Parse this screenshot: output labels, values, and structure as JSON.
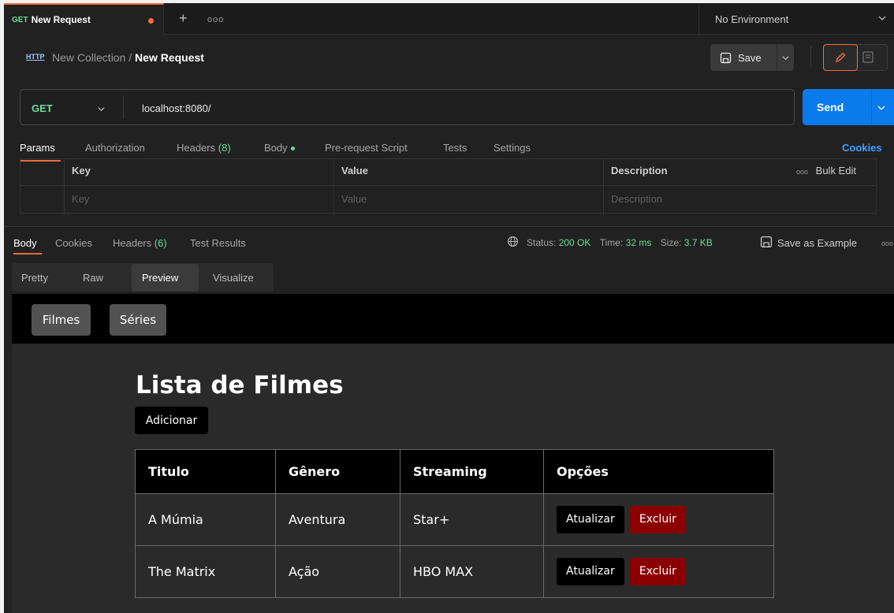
{
  "tab": {
    "method": "GET",
    "title": "New Request",
    "more": "ooo"
  },
  "environment": {
    "label": "No Environment"
  },
  "breadcrumb": {
    "icon_label": "HTTP",
    "collection": "New Collection",
    "separator": "/",
    "request": "New Request"
  },
  "toolbar": {
    "save_label": "Save"
  },
  "request": {
    "method": "GET",
    "url": "localhost:8080/",
    "send_label": "Send"
  },
  "request_tabs": [
    {
      "label": "Params"
    },
    {
      "label": "Authorization"
    },
    {
      "label": "Headers",
      "count": "(8)"
    },
    {
      "label": "Body"
    },
    {
      "label": "Pre-request Script"
    },
    {
      "label": "Tests"
    },
    {
      "label": "Settings"
    }
  ],
  "cookies_label": "Cookies",
  "params_table": {
    "headers": [
      "Key",
      "Value",
      "Description"
    ],
    "placeholders": [
      "Key",
      "Value",
      "Description"
    ],
    "bulk_edit": "Bulk Edit",
    "bulk_more": "ooo"
  },
  "response_tabs": [
    {
      "label": "Body"
    },
    {
      "label": "Cookies"
    },
    {
      "label": "Headers",
      "count": "(6)"
    },
    {
      "label": "Test Results"
    }
  ],
  "status": {
    "status_label": "Status:",
    "status_value": "200 OK",
    "time_label": "Time:",
    "time_value": "32 ms",
    "size_label": "Size:",
    "size_value": "3.7 KB"
  },
  "save_example": "Save as Example",
  "response_more": "ooo",
  "preview_tabs": [
    "Pretty",
    "Raw",
    "Preview",
    "Visualize"
  ],
  "page": {
    "nav": [
      "Filmes",
      "Séries"
    ],
    "title": "Lista de Filmes",
    "add_label": "Adicionar",
    "columns": [
      "Titulo",
      "Gênero",
      "Streaming",
      "Opções"
    ],
    "rows": [
      {
        "titulo": "A Múmia",
        "genero": "Aventura",
        "streaming": "Star+"
      },
      {
        "titulo": "The Matrix",
        "genero": "Ação",
        "streaming": "HBO MAX"
      }
    ],
    "update_label": "Atualizar",
    "delete_label": "Excluir"
  },
  "colors": {
    "accent": "#ff6c37",
    "send": "#097bed",
    "method": "#6bdd9a",
    "cookies": "#3ea0ff",
    "delete": "#8b0000"
  }
}
